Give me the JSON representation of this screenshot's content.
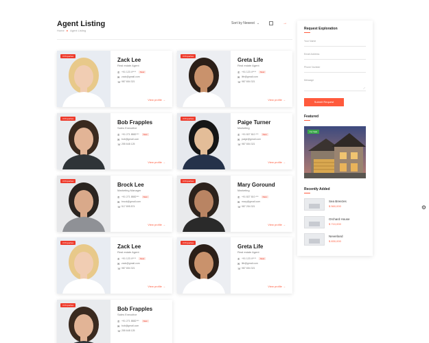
{
  "header": {
    "title": "Agent Listing",
    "breadcrumb": {
      "home": "Home",
      "current": "Agent Listing"
    },
    "sort_label": "Sort by Newest",
    "accent": "#ff5a3c"
  },
  "agents": [
    {
      "badge": "3 Properties",
      "name": "Zack Lee",
      "role": "Real estate Agent",
      "phone": "+91 123 4****",
      "email": "zack@gmail.com",
      "phone2": "987 654 321",
      "view": "View profile",
      "has_tag": true,
      "tag": "New"
    },
    {
      "badge": "3 Properties",
      "name": "Greta Life",
      "role": "Real estate Agent",
      "phone": "+91 123 4****",
      "email": "life@gmail.com",
      "phone2": "987 654 321",
      "view": "View profile",
      "has_tag": true,
      "tag": "New"
    },
    {
      "badge": "3 Properties",
      "name": "Bob Frapples",
      "role": "Sales Executive",
      "phone": "+91 271 8882***",
      "email": "bob@gmail.com",
      "phone2": "255 648 125",
      "view": "View profile",
      "has_tag": true,
      "tag": "New"
    },
    {
      "badge": "3 Properties",
      "name": "Paige Turner",
      "role": "Marketing",
      "phone": "+91 827 810 ***",
      "email": "paige@gmail.com",
      "phone2": "987 654 321",
      "view": "View profile",
      "has_tag": true,
      "tag": "New"
    },
    {
      "badge": "3 Properties",
      "name": "Brock Lee",
      "role": "Marketing Manager",
      "phone": "+91 271 8882***",
      "email": "brock@gmail.com",
      "phone2": "517 895 874",
      "view": "View profile",
      "has_tag": true,
      "tag": "New"
    },
    {
      "badge": "3 Properties",
      "name": "Mary Goround",
      "role": "Marketing",
      "phone": "+91 827 810 ***",
      "email": "mary@gmail.com",
      "phone2": "987 254 321",
      "view": "View profile",
      "has_tag": true,
      "tag": "New"
    },
    {
      "badge": "3 Properties",
      "name": "Zack Lee",
      "role": "Real estate Agent",
      "phone": "+91 123 4****",
      "email": "zack@gmail.com",
      "phone2": "987 654 321",
      "view": "View profile",
      "has_tag": true,
      "tag": "New"
    },
    {
      "badge": "3 Properties",
      "name": "Greta Life",
      "role": "Real estate Agent",
      "phone": "+91 123 4****",
      "email": "life@gmail.com",
      "phone2": "987 654 321",
      "view": "View profile",
      "has_tag": true,
      "tag": "New"
    },
    {
      "badge": "3 Properties",
      "name": "Bob Frapples",
      "role": "Sales Executive",
      "phone": "+91 271 8882***",
      "email": "bob@gmail.com",
      "phone2": "255 648 125",
      "view": "View profile",
      "has_tag": true,
      "tag": "New"
    }
  ],
  "sidebar": {
    "request_title": "Request Exploration",
    "name_placeholder": "Your Name",
    "email_placeholder": "Email Address",
    "phone_placeholder": "Phone Number",
    "message_placeholder": "Message",
    "submit_label": "Submit Request",
    "featured_title": "Featured",
    "featured_badge": "For Sale",
    "recent_title": "Recently Added",
    "recent": [
      {
        "name": "Sea Breezes",
        "price": "$ 560,000"
      },
      {
        "name": "Orchard House",
        "price": "$ 710,000"
      },
      {
        "name": "Neverland",
        "price": "$ 830,000"
      }
    ]
  }
}
